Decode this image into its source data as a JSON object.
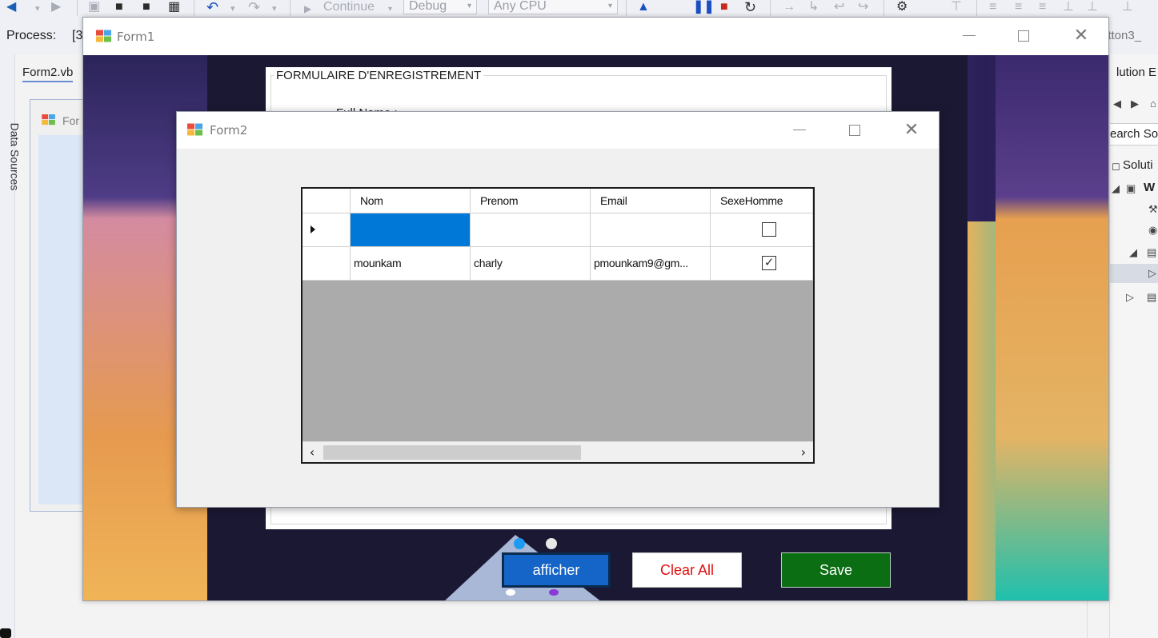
{
  "ide": {
    "toolbar": {
      "continue_label": "Continue",
      "config_value": "Debug",
      "platform_value": "Any CPU"
    },
    "process_label": "Process:",
    "process_value": "[3",
    "right_combo_fragment": "utton3_",
    "document_tab": "Form2.vb",
    "side_panel_label": "Data Sources",
    "designer_title_fragment": "For",
    "solution_title_fragment": "lution E",
    "solution_search_fragment": "earch So",
    "solution_node_fragment": "Soluti",
    "project_node_fragment": "W"
  },
  "form1": {
    "title": "Form1",
    "groupbox_title": "FORMULAIRE D'ENREGISTREMENT",
    "partial_label": "Full Name :",
    "buttons": {
      "afficher": "afficher",
      "clear_all": "Clear All",
      "save": "Save"
    }
  },
  "form2": {
    "title": "Form2",
    "grid": {
      "columns": [
        "Nom",
        "Prenom",
        "Email",
        "SexeHomme"
      ],
      "rows": [
        {
          "nom": "",
          "prenom": "",
          "email": "",
          "sexe_homme": false,
          "current": true
        },
        {
          "nom": "mounkam",
          "prenom": "charly",
          "email": "pmounkam9@gm...",
          "sexe_homme": true,
          "current": false
        }
      ]
    }
  },
  "colors": {
    "afficher_bg": "#1565c8",
    "clear_all_text": "#e01010",
    "save_bg": "#0b6e13",
    "selected_cell": "#0078d7",
    "grid_background": "#ababab"
  }
}
